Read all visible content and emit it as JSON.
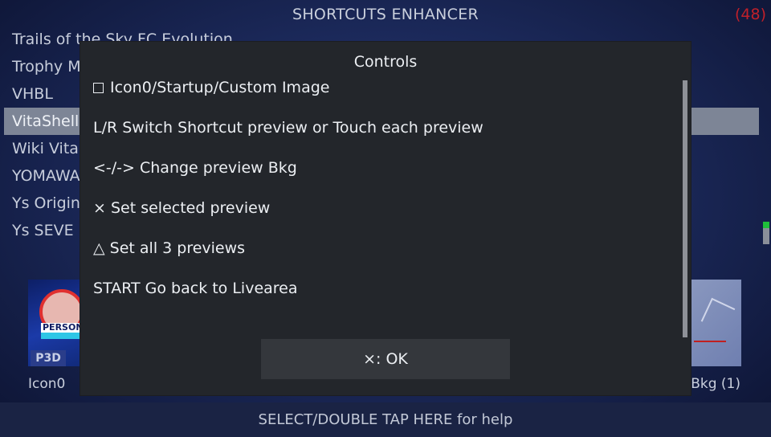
{
  "header": {
    "title": "SHORTCUTS ENHANCER",
    "count": "(48)"
  },
  "list": {
    "items": [
      {
        "label": "Trails of the Sky FC Evolution"
      },
      {
        "label": "Trophy M"
      },
      {
        "label": "VHBL"
      },
      {
        "label": "VitaShell"
      },
      {
        "label": "Wiki Vita"
      },
      {
        "label": "YOMAWA"
      },
      {
        "label": "Ys Origin"
      },
      {
        "label": "Ys SEVE"
      }
    ],
    "selected_index": 3
  },
  "previews": {
    "left_label": "Icon0",
    "left_badge": "P3D",
    "left_logo_text": "PERSONA",
    "right_label": "Bkg (1)"
  },
  "modal": {
    "title": "Controls",
    "lines": [
      {
        "symbol": "square-icon",
        "text": "Icon0/Startup/Custom Image"
      },
      {
        "text": "L/R Switch Shortcut preview or Touch each preview"
      },
      {
        "text": "<-/-> Change preview Bkg"
      },
      {
        "text": "× Set selected preview"
      },
      {
        "text": "△ Set all 3 previews"
      },
      {
        "text": "START Go back to Livearea"
      }
    ],
    "ok_label": "×: OK"
  },
  "footer": {
    "help_text": "SELECT/DOUBLE TAP HERE for help"
  },
  "colors": {
    "count": "#c0202a",
    "selected_row": "#7d8596",
    "modal_bg": "#23262b",
    "scroll_indicator": "#1fbf3a"
  }
}
